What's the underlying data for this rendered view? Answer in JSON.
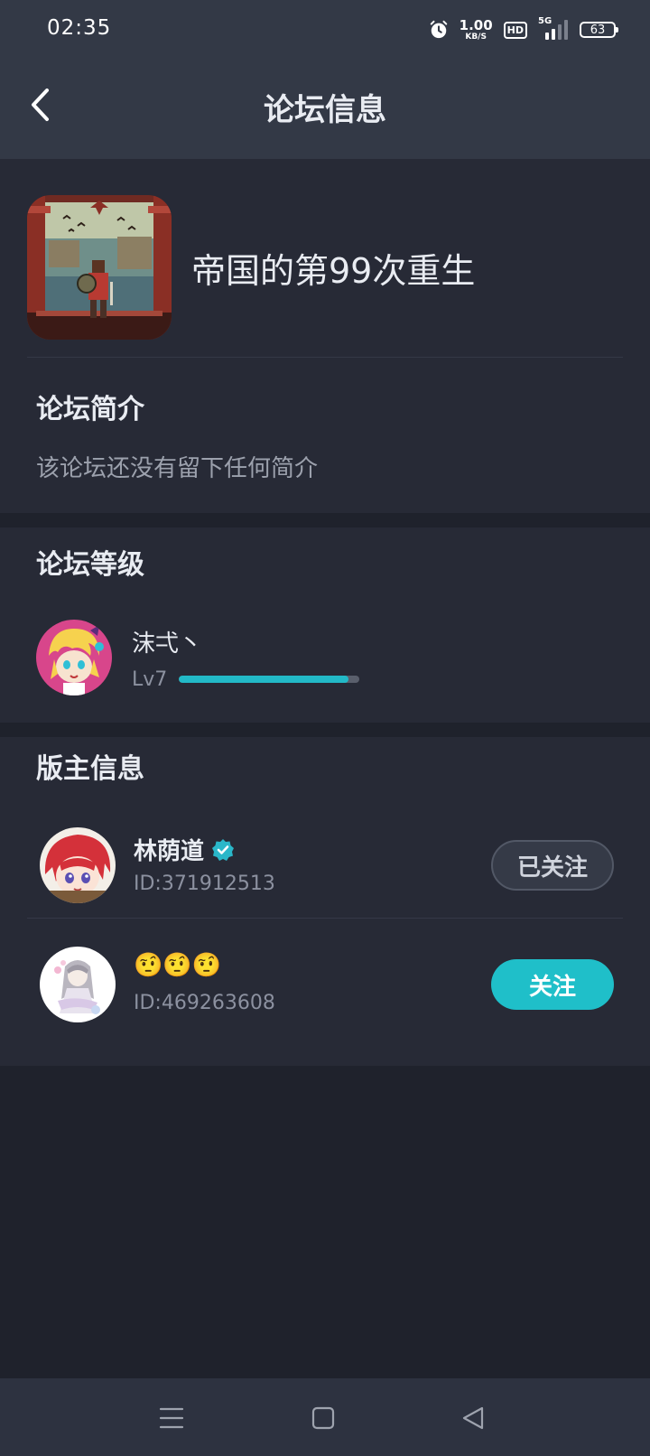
{
  "status_bar": {
    "time": "02:35",
    "net_speed_value": "1.00",
    "net_speed_unit": "KB/S",
    "hd_label": "HD",
    "network_type": "5G",
    "battery_level": "63",
    "icons": [
      "alarm-icon",
      "hd-icon",
      "signal-icon",
      "battery-icon"
    ]
  },
  "header": {
    "title": "论坛信息",
    "back_icon": "chevron-left-icon"
  },
  "forum": {
    "name": "帝国的第99次重生",
    "cover_alt": "pixel art knight cover"
  },
  "intro": {
    "title": "论坛简介",
    "text": "该论坛还没有留下任何简介"
  },
  "level": {
    "title": "论坛等级",
    "user_name": "沫弌丶",
    "badge": "Lv7",
    "progress": 0.94,
    "colors": {
      "fill": "#22b9c7",
      "track": "#5a5f6c"
    }
  },
  "moderators": {
    "title": "版主信息",
    "items": [
      {
        "name": "林荫道",
        "verified": true,
        "id_text": "ID:371912513",
        "button_label": "已关注",
        "following": true
      },
      {
        "name": "🤨🤨🤨",
        "verified": false,
        "id_text": "ID:469263608",
        "button_label": "关注",
        "following": false
      }
    ]
  },
  "nav_bar": {
    "icons": [
      "menu-icon",
      "home-square-icon",
      "back-triangle-icon"
    ]
  },
  "colors": {
    "accent": "#1fbfc9",
    "page_bg": "#1f222c",
    "card_bg": "#272a36",
    "header_bg": "#333946"
  }
}
